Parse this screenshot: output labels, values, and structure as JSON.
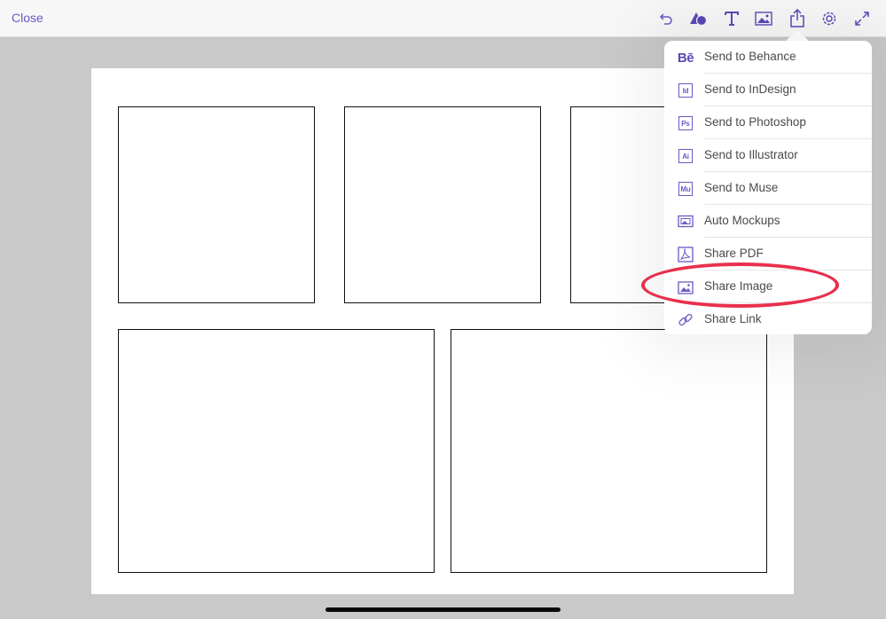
{
  "topbar": {
    "close_label": "Close",
    "icons": [
      "undo-icon",
      "shapes-icon",
      "text-icon",
      "image-icon",
      "share-icon",
      "settings-icon",
      "fullscreen-icon"
    ]
  },
  "share_menu": {
    "items": [
      {
        "label": "Send to Behance",
        "icon": "behance-icon",
        "badge": "Bē"
      },
      {
        "label": "Send to InDesign",
        "icon": "indesign-icon",
        "badge": "Id"
      },
      {
        "label": "Send to Photoshop",
        "icon": "photoshop-icon",
        "badge": "Ps"
      },
      {
        "label": "Send to Illustrator",
        "icon": "illustrator-icon",
        "badge": "Ai"
      },
      {
        "label": "Send to Muse",
        "icon": "muse-icon",
        "badge": "Mu"
      },
      {
        "label": "Auto Mockups",
        "icon": "mockups-icon"
      },
      {
        "label": "Share PDF",
        "icon": "pdf-icon"
      },
      {
        "label": "Share Image",
        "icon": "share-image-icon",
        "highlighted": true
      },
      {
        "label": "Share Link",
        "icon": "link-icon"
      }
    ]
  },
  "colors": {
    "accent": "#6a58c4",
    "highlight": "#e8304c",
    "workspace": "#c9c9c9"
  }
}
